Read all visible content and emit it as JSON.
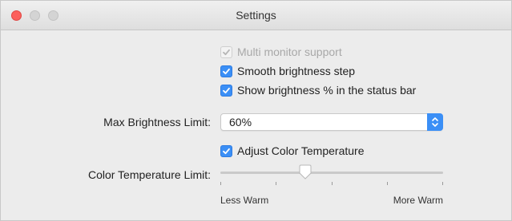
{
  "window": {
    "title": "Settings"
  },
  "checkboxes": [
    {
      "label": "Multi monitor support",
      "checked": true,
      "enabled": false
    },
    {
      "label": "Smooth brightness step",
      "checked": true,
      "enabled": true
    },
    {
      "label": "Show brightness % in the status bar",
      "checked": true,
      "enabled": true
    }
  ],
  "max_brightness": {
    "label": "Max Brightness Limit:",
    "value": "60%"
  },
  "adjust_color": {
    "label": "Adjust Color Temperature",
    "checked": true,
    "enabled": true
  },
  "color_temp": {
    "label": "Color Temperature Limit:",
    "min_label": "Less Warm",
    "max_label": "More Warm",
    "value": 0.38,
    "tick_count": 5
  },
  "colors": {
    "accent": "#3b8ff6",
    "close": "#fc605c"
  }
}
